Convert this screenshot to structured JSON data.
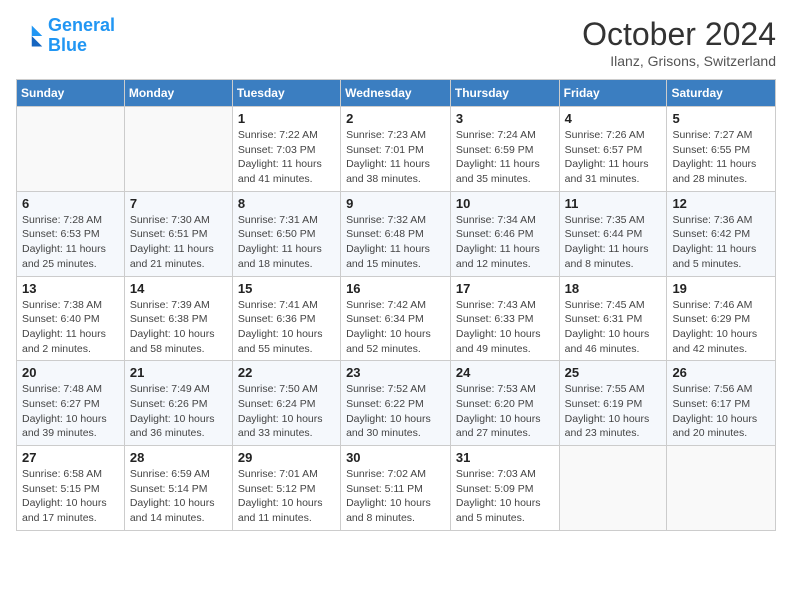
{
  "logo": {
    "line1": "General",
    "line2": "Blue"
  },
  "title": "October 2024",
  "subtitle": "Ilanz, Grisons, Switzerland",
  "days_header": [
    "Sunday",
    "Monday",
    "Tuesday",
    "Wednesday",
    "Thursday",
    "Friday",
    "Saturday"
  ],
  "weeks": [
    [
      {
        "num": "",
        "info": ""
      },
      {
        "num": "",
        "info": ""
      },
      {
        "num": "1",
        "info": "Sunrise: 7:22 AM\nSunset: 7:03 PM\nDaylight: 11 hours and 41 minutes."
      },
      {
        "num": "2",
        "info": "Sunrise: 7:23 AM\nSunset: 7:01 PM\nDaylight: 11 hours and 38 minutes."
      },
      {
        "num": "3",
        "info": "Sunrise: 7:24 AM\nSunset: 6:59 PM\nDaylight: 11 hours and 35 minutes."
      },
      {
        "num": "4",
        "info": "Sunrise: 7:26 AM\nSunset: 6:57 PM\nDaylight: 11 hours and 31 minutes."
      },
      {
        "num": "5",
        "info": "Sunrise: 7:27 AM\nSunset: 6:55 PM\nDaylight: 11 hours and 28 minutes."
      }
    ],
    [
      {
        "num": "6",
        "info": "Sunrise: 7:28 AM\nSunset: 6:53 PM\nDaylight: 11 hours and 25 minutes."
      },
      {
        "num": "7",
        "info": "Sunrise: 7:30 AM\nSunset: 6:51 PM\nDaylight: 11 hours and 21 minutes."
      },
      {
        "num": "8",
        "info": "Sunrise: 7:31 AM\nSunset: 6:50 PM\nDaylight: 11 hours and 18 minutes."
      },
      {
        "num": "9",
        "info": "Sunrise: 7:32 AM\nSunset: 6:48 PM\nDaylight: 11 hours and 15 minutes."
      },
      {
        "num": "10",
        "info": "Sunrise: 7:34 AM\nSunset: 6:46 PM\nDaylight: 11 hours and 12 minutes."
      },
      {
        "num": "11",
        "info": "Sunrise: 7:35 AM\nSunset: 6:44 PM\nDaylight: 11 hours and 8 minutes."
      },
      {
        "num": "12",
        "info": "Sunrise: 7:36 AM\nSunset: 6:42 PM\nDaylight: 11 hours and 5 minutes."
      }
    ],
    [
      {
        "num": "13",
        "info": "Sunrise: 7:38 AM\nSunset: 6:40 PM\nDaylight: 11 hours and 2 minutes."
      },
      {
        "num": "14",
        "info": "Sunrise: 7:39 AM\nSunset: 6:38 PM\nDaylight: 10 hours and 58 minutes."
      },
      {
        "num": "15",
        "info": "Sunrise: 7:41 AM\nSunset: 6:36 PM\nDaylight: 10 hours and 55 minutes."
      },
      {
        "num": "16",
        "info": "Sunrise: 7:42 AM\nSunset: 6:34 PM\nDaylight: 10 hours and 52 minutes."
      },
      {
        "num": "17",
        "info": "Sunrise: 7:43 AM\nSunset: 6:33 PM\nDaylight: 10 hours and 49 minutes."
      },
      {
        "num": "18",
        "info": "Sunrise: 7:45 AM\nSunset: 6:31 PM\nDaylight: 10 hours and 46 minutes."
      },
      {
        "num": "19",
        "info": "Sunrise: 7:46 AM\nSunset: 6:29 PM\nDaylight: 10 hours and 42 minutes."
      }
    ],
    [
      {
        "num": "20",
        "info": "Sunrise: 7:48 AM\nSunset: 6:27 PM\nDaylight: 10 hours and 39 minutes."
      },
      {
        "num": "21",
        "info": "Sunrise: 7:49 AM\nSunset: 6:26 PM\nDaylight: 10 hours and 36 minutes."
      },
      {
        "num": "22",
        "info": "Sunrise: 7:50 AM\nSunset: 6:24 PM\nDaylight: 10 hours and 33 minutes."
      },
      {
        "num": "23",
        "info": "Sunrise: 7:52 AM\nSunset: 6:22 PM\nDaylight: 10 hours and 30 minutes."
      },
      {
        "num": "24",
        "info": "Sunrise: 7:53 AM\nSunset: 6:20 PM\nDaylight: 10 hours and 27 minutes."
      },
      {
        "num": "25",
        "info": "Sunrise: 7:55 AM\nSunset: 6:19 PM\nDaylight: 10 hours and 23 minutes."
      },
      {
        "num": "26",
        "info": "Sunrise: 7:56 AM\nSunset: 6:17 PM\nDaylight: 10 hours and 20 minutes."
      }
    ],
    [
      {
        "num": "27",
        "info": "Sunrise: 6:58 AM\nSunset: 5:15 PM\nDaylight: 10 hours and 17 minutes."
      },
      {
        "num": "28",
        "info": "Sunrise: 6:59 AM\nSunset: 5:14 PM\nDaylight: 10 hours and 14 minutes."
      },
      {
        "num": "29",
        "info": "Sunrise: 7:01 AM\nSunset: 5:12 PM\nDaylight: 10 hours and 11 minutes."
      },
      {
        "num": "30",
        "info": "Sunrise: 7:02 AM\nSunset: 5:11 PM\nDaylight: 10 hours and 8 minutes."
      },
      {
        "num": "31",
        "info": "Sunrise: 7:03 AM\nSunset: 5:09 PM\nDaylight: 10 hours and 5 minutes."
      },
      {
        "num": "",
        "info": ""
      },
      {
        "num": "",
        "info": ""
      }
    ]
  ]
}
